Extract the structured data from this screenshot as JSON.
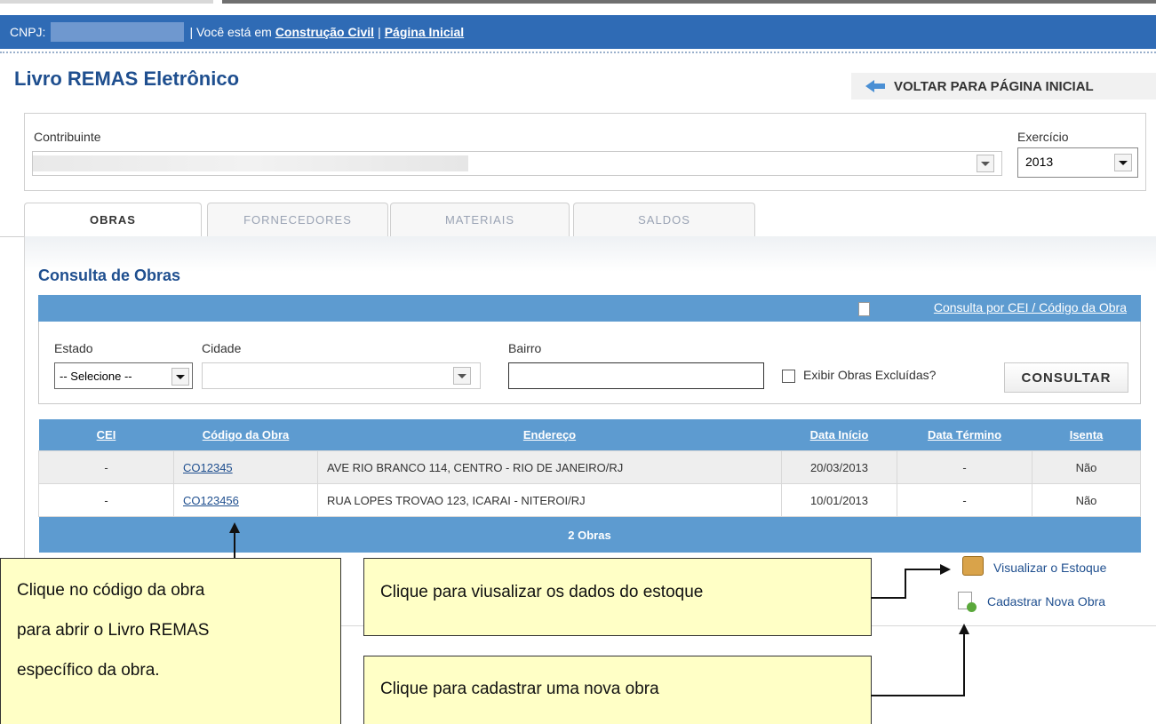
{
  "topbar": {
    "cnpj_label": "CNPJ:",
    "you_are_in": "| Você está em",
    "link_construcao": "Construção Civil",
    "sep": "|",
    "link_home": "Página Inicial"
  },
  "page_title": "Livro REMAS Eletrônico",
  "back_button": "VOLTAR PARA PÁGINA INICIAL",
  "contribuinte": {
    "label": "Contribuinte",
    "exercicio_label": "Exercício",
    "exercicio_value": "2013"
  },
  "tabs": [
    "OBRAS",
    "FORNECEDORES",
    "MATERIAIS",
    "SALDOS"
  ],
  "consulta": {
    "title": "Consulta de Obras",
    "cei_link": "Consulta por CEI / Código da Obra",
    "estado_label": "Estado",
    "estado_value": "-- Selecione --",
    "cidade_label": "Cidade",
    "bairro_label": "Bairro",
    "exibir_excluidas": "Exibir Obras Excluídas?",
    "consultar_button": "CONSULTAR"
  },
  "table": {
    "headers": [
      "CEI",
      "Código da Obra",
      "Endereço",
      "Data Início",
      "Data Término",
      "Isenta"
    ],
    "rows": [
      [
        "-",
        "CO12345",
        "AVE RIO BRANCO 114, CENTRO - RIO DE JANEIRO/RJ",
        "20/03/2013",
        "-",
        "Não"
      ],
      [
        "-",
        "CO123456",
        "RUA LOPES TROVAO 123, ICARAI - NITEROI/RJ",
        "10/01/2013",
        "-",
        "Não"
      ]
    ],
    "footer": "2 Obras"
  },
  "side_links": {
    "estoque": "Visualizar o Estoque",
    "nova_obra": "Cadastrar Nova Obra"
  },
  "callouts": {
    "codigo_line1": "Clique no código da obra",
    "codigo_line2": "para abrir o Livro REMAS",
    "codigo_line3": "específico da obra.",
    "estoque": "Clique para viusalizar os dados do estoque",
    "nova_obra": "Clique para cadastrar uma nova obra"
  }
}
